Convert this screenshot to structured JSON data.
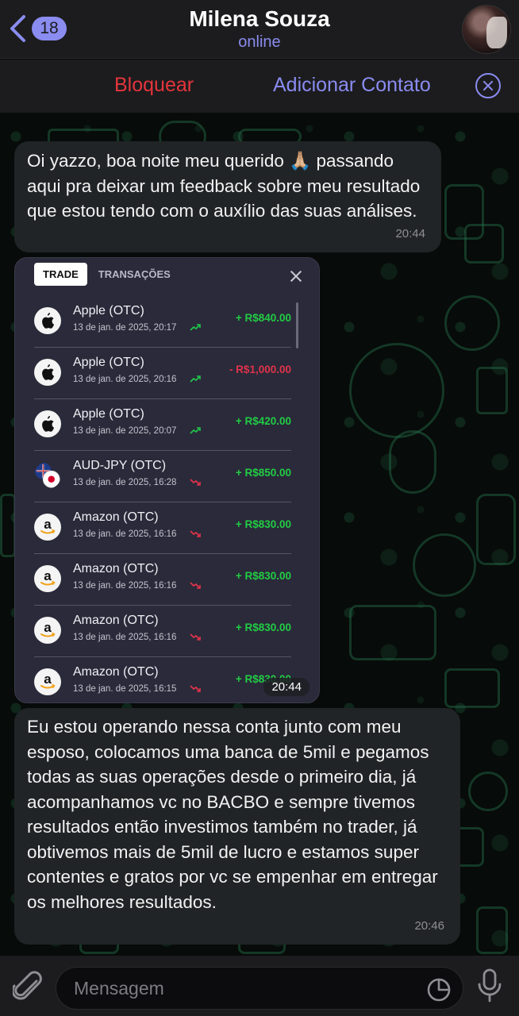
{
  "header": {
    "unread_count": "18",
    "contact_name": "Milena Souza",
    "contact_status": "online"
  },
  "action_bar": {
    "block_label": "Bloquear",
    "add_contact_label": "Adicionar Contato"
  },
  "messages": [
    {
      "text": "Oi yazzo, boa noite meu querido 🙏🏼 passando aqui pra deixar um feedback sobre meu resultado que estou tendo com o auxílio das suas análises.",
      "time": "20:44"
    },
    {
      "text": "Eu estou operando nessa conta junto com meu esposo, colocamos uma banca de 5mil e pegamos todas as suas operações desde o primeiro dia, já acompanhamos vc no BACBO e sempre tivemos resultados então investimos também no trader, já obtivemos mais de 5mil de lucro e estamos super contentes e gratos por vc se empenhar em entregar os melhores resultados.",
      "time": "20:46"
    }
  ],
  "screenshot": {
    "time": "20:44",
    "tabs": [
      "TRADE",
      "TRANSAÇÕES"
    ],
    "trades": [
      {
        "asset": "Apple (OTC)",
        "date": "13 de jan. de 2025, 20:17",
        "trend": "up",
        "amount": "+ R$840.00",
        "result": "positive",
        "icon": "apple-icon"
      },
      {
        "asset": "Apple (OTC)",
        "date": "13 de jan. de 2025, 20:16",
        "trend": "up",
        "amount": "- R$1,000.00",
        "result": "negative",
        "icon": "apple-icon"
      },
      {
        "asset": "Apple (OTC)",
        "date": "13 de jan. de 2025, 20:07",
        "trend": "up",
        "amount": "+ R$420.00",
        "result": "positive",
        "icon": "apple-icon"
      },
      {
        "asset": "AUD-JPY (OTC)",
        "date": "13 de jan. de 2025, 16:28",
        "trend": "down",
        "amount": "+ R$850.00",
        "result": "positive",
        "icon": "aud-jpy-flag-icon"
      },
      {
        "asset": "Amazon (OTC)",
        "date": "13 de jan. de 2025, 16:16",
        "trend": "down",
        "amount": "+ R$830.00",
        "result": "positive",
        "icon": "amazon-icon"
      },
      {
        "asset": "Amazon (OTC)",
        "date": "13 de jan. de 2025, 16:16",
        "trend": "down",
        "amount": "+ R$830.00",
        "result": "positive",
        "icon": "amazon-icon"
      },
      {
        "asset": "Amazon (OTC)",
        "date": "13 de jan. de 2025, 16:16",
        "trend": "down",
        "amount": "+ R$830.00",
        "result": "positive",
        "icon": "amazon-icon"
      },
      {
        "asset": "Amazon (OTC)",
        "date": "13 de jan. de 2025, 16:15",
        "trend": "down",
        "amount": "+ R$830.00",
        "result": "positive",
        "icon": "amazon-icon"
      }
    ]
  },
  "input_bar": {
    "placeholder": "Mensagem"
  },
  "colors": {
    "accent": "#8a8cf0",
    "danger": "#e5343c",
    "positive": "#22cc44",
    "negative": "#e0334a"
  }
}
